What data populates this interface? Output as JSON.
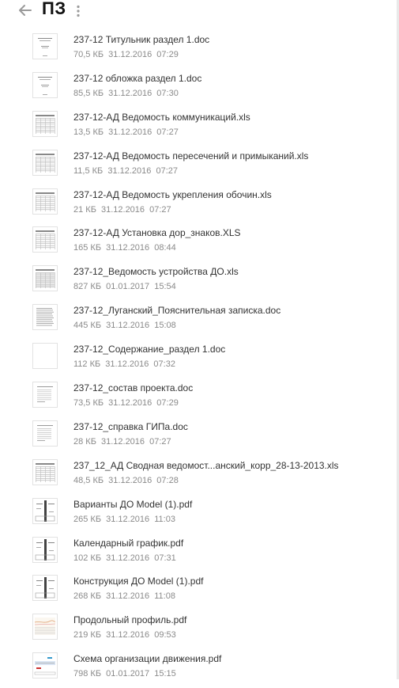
{
  "header": {
    "title": "ПЗ"
  },
  "files": [
    {
      "name": "237-12 Титульник раздел 1.doc",
      "size": "70,5 КБ",
      "date": "31.12.2016",
      "time": "07:29",
      "thumb": "doc-title"
    },
    {
      "name": "237-12 обложка раздел 1.doc",
      "size": "85,5 КБ",
      "date": "31.12.2016",
      "time": "07:30",
      "thumb": "doc-title"
    },
    {
      "name": "237-12-АД Ведомость коммуникаций.xls",
      "size": "13,5 КБ",
      "date": "31.12.2016",
      "time": "07:27",
      "thumb": "table"
    },
    {
      "name": "237-12-АД Ведомость пересечений и примыканий.xls",
      "size": "11,5 КБ",
      "date": "31.12.2016",
      "time": "07:27",
      "thumb": "table"
    },
    {
      "name": "237-12-АД Ведомость укрепления обочин.xls",
      "size": "21 КБ",
      "date": "31.12.2016",
      "time": "07:27",
      "thumb": "table"
    },
    {
      "name": "237-12-АД Установка дор_знаков.XLS",
      "size": "165 КБ",
      "date": "31.12.2016",
      "time": "08:44",
      "thumb": "table"
    },
    {
      "name": "237-12_Ведомость устройства ДО.xls",
      "size": "827 КБ",
      "date": "01.01.2017",
      "time": "15:54",
      "thumb": "table-dense"
    },
    {
      "name": "237-12_Луганский_Пояснительная записка.doc",
      "size": "445 КБ",
      "date": "31.12.2016",
      "time": "15:08",
      "thumb": "doc-text"
    },
    {
      "name": "237-12_Содержание_раздел 1.doc",
      "size": "112 КБ",
      "date": "31.12.2016",
      "time": "07:32",
      "thumb": "blank"
    },
    {
      "name": "237-12_состав проекта.doc",
      "size": "73,5 КБ",
      "date": "31.12.2016",
      "time": "07:29",
      "thumb": "doc-list"
    },
    {
      "name": "237-12_справка ГИПа.doc",
      "size": "28 КБ",
      "date": "31.12.2016",
      "time": "07:27",
      "thumb": "doc-list"
    },
    {
      "name": "237_12_АД Сводная ведомост...анский_корр_28-13-2013.xls",
      "size": "48,5 КБ",
      "date": "31.12.2016",
      "time": "07:28",
      "thumb": "table"
    },
    {
      "name": "Варианты ДО Model (1).pdf",
      "size": "265 КБ",
      "date": "31.12.2016",
      "time": "11:03",
      "thumb": "drawing-dark"
    },
    {
      "name": "Календарный график.pdf",
      "size": "102 КБ",
      "date": "31.12.2016",
      "time": "07:31",
      "thumb": "drawing-dark"
    },
    {
      "name": "Конструкция ДО Model (1).pdf",
      "size": "268 КБ",
      "date": "31.12.2016",
      "time": "11:08",
      "thumb": "drawing-dark"
    },
    {
      "name": "Продольный профиль.pdf",
      "size": "219 КБ",
      "date": "31.12.2016",
      "time": "09:53",
      "thumb": "profile"
    },
    {
      "name": "Схема организации движения.pdf",
      "size": "798 КБ",
      "date": "01.01.2017",
      "time": "15:15",
      "thumb": "scheme"
    }
  ]
}
